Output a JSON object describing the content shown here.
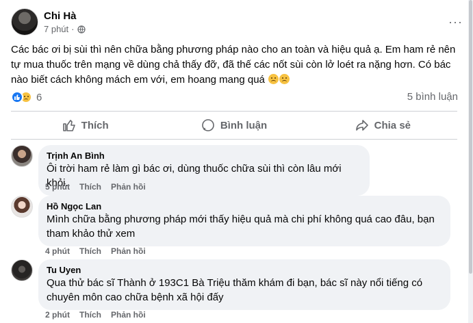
{
  "post": {
    "author": "Chi Hà",
    "time": "7 phút",
    "more_label": "···",
    "text": "Các bác ơi bị sùi thì nên chữa bằng phương pháp nào cho an toàn và hiệu quả ạ. Em ham rẻ nên tự mua thuốc trên mạng về dùng chả thấy đỡ, đã thế các nốt sùi còn lở loét ra nặng hơn. Có bác nào biết cách không mách em với, em hoang mang quá",
    "reaction_count": "6",
    "comment_count": "5 bình luận"
  },
  "actions": {
    "like": "Thích",
    "comment": "Bình luận",
    "share": "Chia sẻ"
  },
  "comments": [
    {
      "name": "Trịnh An Bình",
      "text": "Ôi trời ham rẻ làm gì bác ơi, dùng thuốc chữa sùi thì còn lâu mới khỏi.",
      "time": "5 phút",
      "like": "Thích",
      "reply": "Phản hồi"
    },
    {
      "name": "Hồ Ngọc Lan",
      "text": "Mình chữa bằng phương pháp mới thấy hiệu quả mà chi phí không quá cao đâu, bạn tham khảo thử xem",
      "time": "4 phút",
      "like": "Thích",
      "reply": "Phản hồi"
    },
    {
      "name": "Tu Uyen",
      "text": "Qua thử bác sĩ Thành ở 193C1 Bà Triệu thăm khám đi bạn, bác sĩ này nổi tiếng có chuyên môn cao chữa bệnh xã hội đấy",
      "time": "2 phút",
      "like": "Thích",
      "reply": "Phản hồi"
    }
  ],
  "colors": {
    "accent": "#1877f2",
    "secondary_text": "#65676b",
    "bubble": "#f0f2f5"
  }
}
